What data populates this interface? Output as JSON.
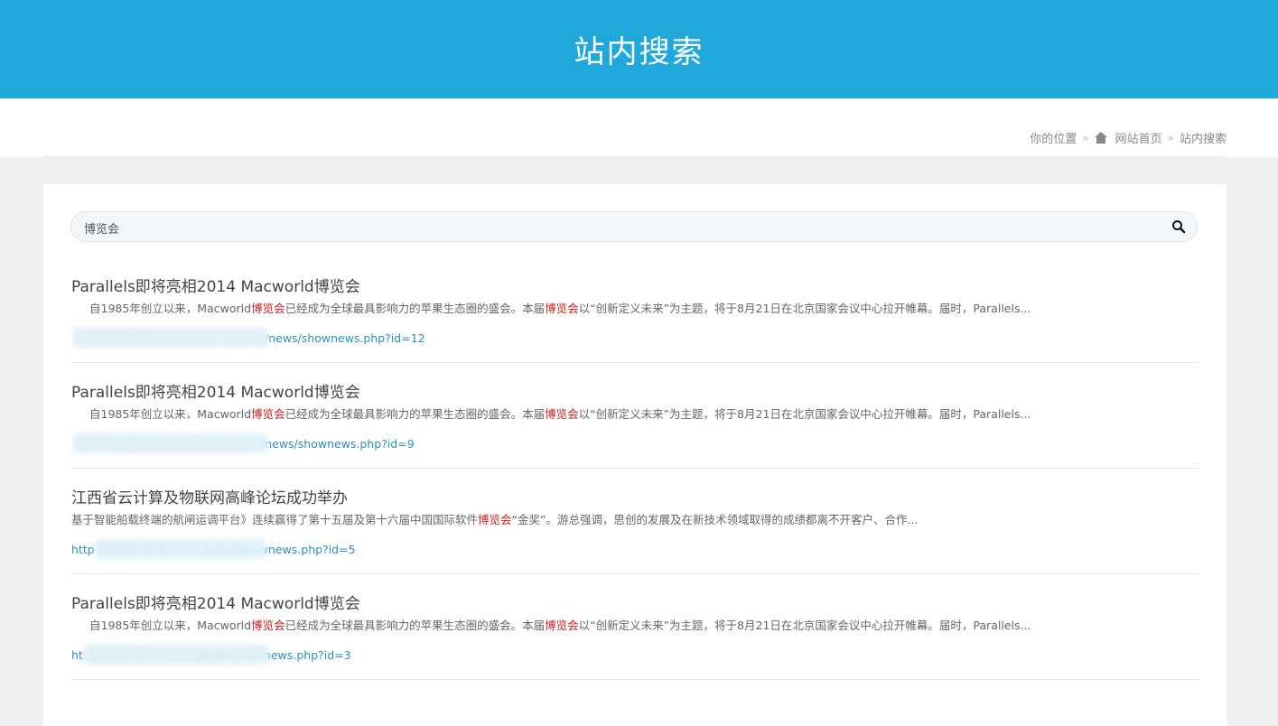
{
  "header": {
    "title": "站内搜索"
  },
  "breadcrumb": {
    "prefix": "你的位置",
    "sep": "»",
    "home": "网站首页",
    "current": "站内搜索"
  },
  "search": {
    "value": "博览会"
  },
  "results": [
    {
      "title": "Parallels即将亮相2014 Macworld博览会",
      "snippet_parts": [
        "自1985年创立以来，Macworld",
        "博览会",
        "已经成为全球最具影响力的苹果生态圈的盛会。本届",
        "博览会",
        "以“创新定义未来”为主题，将于8月21日在北京国家会议中心拉开帷幕。届时，Parallels..."
      ],
      "url": "/news/shownews.php?id=12"
    },
    {
      "title": "Parallels即将亮相2014 Macworld博览会",
      "snippet_parts": [
        "自1985年创立以来，Macworld",
        "博览会",
        "已经成为全球最具影响力的苹果生态圈的盛会。本届",
        "博览会",
        "以“创新定义未来”为主题，将于8月21日在北京国家会议中心拉开帷幕。届时，Parallels..."
      ],
      "url": "/news/shownews.php?id=9"
    },
    {
      "title": "江西省云计算及物联网高峰论坛成功举办",
      "snippet_parts": [
        "基于智能船载终端的航闸运调平台》连续赢得了第十五届及第十六届中国国际软件",
        "博览会",
        "“金奖”。游总强调，思创的发展及在新技术领域取得的成绩都离不开客户、合作..."
      ],
      "url": "http                              /news/shownews.php?id=5"
    },
    {
      "title": "Parallels即将亮相2014 Macworld博览会",
      "snippet_parts": [
        "自1985年创立以来，Macworld",
        "博览会",
        "已经成为全球最具影响力的苹果生态圈的盛会。本届",
        "博览会",
        "以“创新定义未来”为主题，将于8月21日在北京国家会议中心拉开帷幕。届时，Parallels..."
      ],
      "url": "ht                                /news/shownews.php?id=3"
    }
  ],
  "colors": {
    "banner": "#1fa8d9",
    "highlight": "#d21b1b",
    "link": "#2a8fc4"
  }
}
